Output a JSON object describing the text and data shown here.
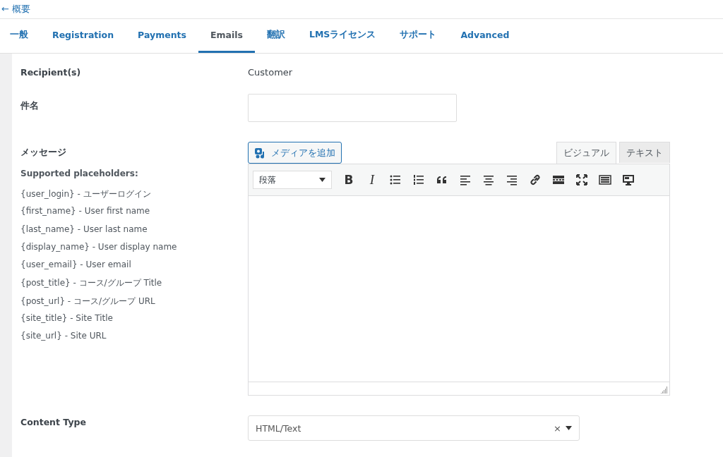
{
  "back_link": "← 概要",
  "tabs": [
    {
      "label": "一般",
      "selected": false
    },
    {
      "label": "Registration",
      "selected": false
    },
    {
      "label": "Payments",
      "selected": false
    },
    {
      "label": "Emails",
      "selected": true
    },
    {
      "label": "翻訳",
      "selected": false
    },
    {
      "label": "LMSライセンス",
      "selected": false
    },
    {
      "label": "サポート",
      "selected": false
    },
    {
      "label": "Advanced",
      "selected": false
    }
  ],
  "recipients": {
    "label": "Recipient(s)",
    "value": "Customer"
  },
  "subject": {
    "label": "件名"
  },
  "message": {
    "label": "メッセージ",
    "placeholders_title": "Supported placeholders:",
    "placeholders": [
      "{user_login} - ユーザーログイン",
      "{first_name} - User first name",
      "{last_name} - User last name",
      "{display_name} - User display name",
      "{user_email} - User email",
      "{post_title} - コース/グループ Title",
      "{post_url} - コース/グループ URL",
      "{site_title} - Site Title",
      "{site_url} - Site URL"
    ]
  },
  "editor": {
    "add_media": "メディアを追加",
    "mode_tabs": [
      {
        "label": "ビジュアル",
        "selected": true
      },
      {
        "label": "テキスト",
        "selected": false
      }
    ],
    "format": "段落",
    "toolbar": [
      {
        "kind": "bold",
        "glyph": "B"
      },
      {
        "kind": "italic",
        "glyph": "I"
      },
      {
        "kind": "bullet-list"
      },
      {
        "kind": "numbered-list"
      },
      {
        "kind": "quote"
      },
      {
        "kind": "align-left"
      },
      {
        "kind": "align-center"
      },
      {
        "kind": "align-right"
      },
      {
        "kind": "link"
      },
      {
        "kind": "more"
      },
      {
        "kind": "fullscreen"
      },
      {
        "kind": "keyboard"
      },
      {
        "kind": "monitor"
      }
    ]
  },
  "content_type": {
    "label": "Content Type",
    "value": "HTML/Text",
    "clear": "×"
  }
}
